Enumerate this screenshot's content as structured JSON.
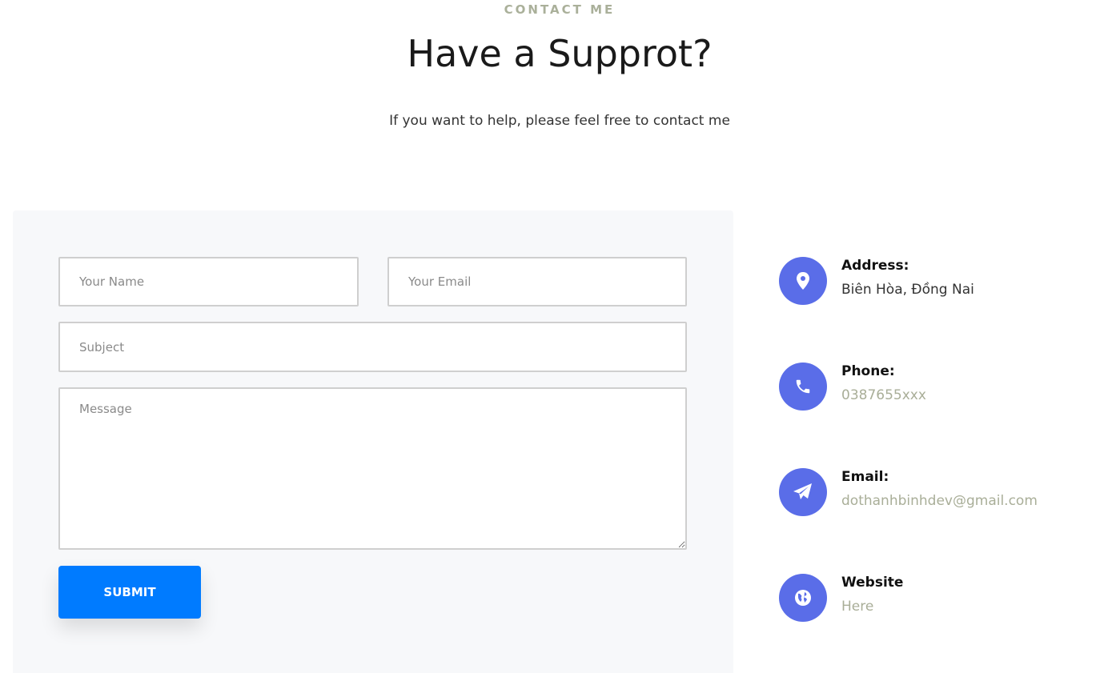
{
  "header": {
    "eyebrow": "CONTACT ME",
    "title": "Have a Supprot?",
    "subtitle": "If you want to help, please feel free to contact me"
  },
  "form": {
    "name_placeholder": "Your Name",
    "email_placeholder": "Your Email",
    "subject_placeholder": "Subject",
    "message_placeholder": "Message",
    "submit_label": "SUBMIT"
  },
  "contact_info": {
    "address": {
      "label": "Address:",
      "value": "Biên Hòa, Đồng Nai",
      "icon": "map-marker-icon"
    },
    "phone": {
      "label": "Phone:",
      "value": "0387655xxx",
      "icon": "phone-icon"
    },
    "email": {
      "label": "Email:",
      "value": "dothanhbinhdev@gmail.com",
      "icon": "paper-plane-icon"
    },
    "website": {
      "label": "Website",
      "value": "Here",
      "icon": "globe-icon"
    }
  },
  "colors": {
    "accent": "#5a6de8",
    "submit": "#007bff",
    "muted_text": "#a9ae98",
    "panel_bg": "#f7f8fa"
  }
}
